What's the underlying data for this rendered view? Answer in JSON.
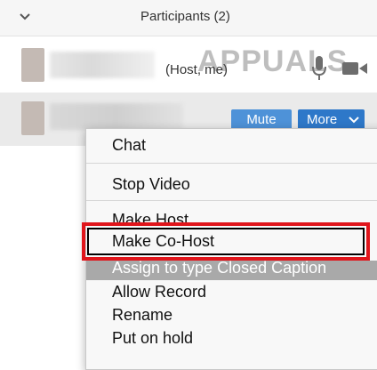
{
  "header": {
    "title": "Participants (2)"
  },
  "participants": [
    {
      "name": "",
      "role_label": "(Host, me)"
    },
    {
      "name": "",
      "buttons": {
        "mute": "Mute",
        "more": "More"
      }
    }
  ],
  "watermark": "APPUALS",
  "menu": {
    "items": [
      "Chat",
      "Stop Video",
      "Make Host",
      "Make Co-Host",
      "Assign to type Closed Caption",
      "Allow Record",
      "Rename",
      "Put on hold"
    ]
  },
  "colors": {
    "accent": "#2e78c9",
    "mute_button": "#4e92d8",
    "highlight": "#e0151b"
  },
  "icons": [
    "chevron-down-icon",
    "microphone-icon",
    "video-camera-icon"
  ]
}
